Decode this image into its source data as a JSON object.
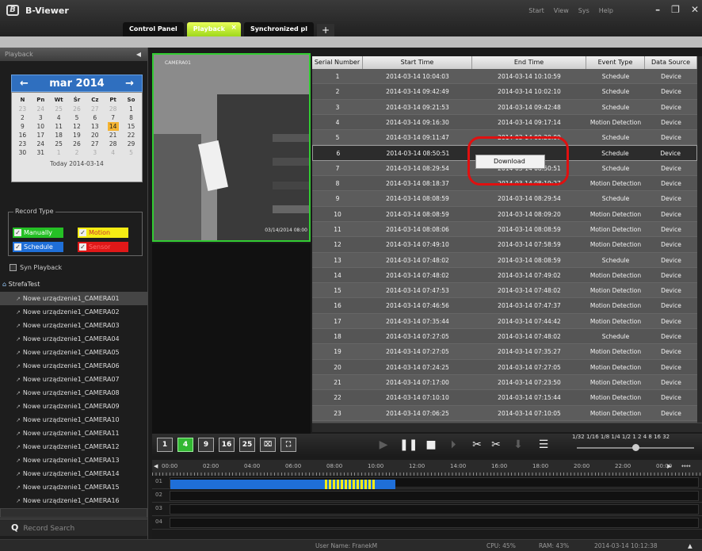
{
  "app": {
    "title": "B-Viewer",
    "logo_letter": "B"
  },
  "top_menu": [
    "Start",
    "View",
    "Sys",
    "Help"
  ],
  "tabs": [
    {
      "label": "Control Panel",
      "active": false
    },
    {
      "label": "Playback",
      "active": true,
      "close": "×"
    },
    {
      "label": "Synchronized pl",
      "active": false
    }
  ],
  "tab_add": "+",
  "left_panel": {
    "title": "Playback",
    "calendar": {
      "month": "mar",
      "year": "2014",
      "dow": [
        "N",
        "Pn",
        "Wt",
        "Śr",
        "Cz",
        "Pt",
        "So"
      ],
      "weeks": [
        [
          "23",
          "24",
          "25",
          "26",
          "27",
          "28",
          "1"
        ],
        [
          "2",
          "3",
          "4",
          "5",
          "6",
          "7",
          "8"
        ],
        [
          "9",
          "10",
          "11",
          "12",
          "13",
          "14",
          "15"
        ],
        [
          "16",
          "17",
          "18",
          "19",
          "20",
          "21",
          "22"
        ],
        [
          "23",
          "24",
          "25",
          "26",
          "27",
          "28",
          "29"
        ],
        [
          "30",
          "31",
          "1",
          "2",
          "3",
          "4",
          "5"
        ]
      ],
      "selected_day": "14",
      "today": "Today 2014-03-14"
    },
    "record_type": {
      "legend": "Record Type",
      "manually": "Manually",
      "motion": "Motion",
      "schedule": "Schedule",
      "sensor": "Sensor"
    },
    "syn_playback": "Syn Playback",
    "tree_root": "StrefaTest",
    "cameras": [
      "Nowe urządzenie1_CAMERA01",
      "Nowe urządzenie1_CAMERA02",
      "Nowe urządzenie1_CAMERA03",
      "Nowe urządzenie1_CAMERA04",
      "Nowe urządzenie1_CAMERA05",
      "Nowe urządzenie1_CAMERA06",
      "Nowe urządzenie1_CAMERA07",
      "Nowe urządzenie1_CAMERA08",
      "Nowe urządzenie1_CAMERA09",
      "Nowe urządzenie1_CAMERA10",
      "Nowe urządzenie1_CAMERA11",
      "Nowe urządzenie1_CAMERA12",
      "Nowe urządzenie1_CAMERA13",
      "Nowe urządzenie1_CAMERA14",
      "Nowe urządzenie1_CAMERA15",
      "Nowe urządzenie1_CAMERA16"
    ],
    "selected_camera": 0,
    "search_label": "Record Search"
  },
  "video": {
    "camera_label": "CAMERA01",
    "timestamp": "03/14/2014 08:00"
  },
  "table": {
    "headers": [
      "Serial Number",
      "Start Time",
      "End Time",
      "Event Type",
      "Data Source"
    ],
    "selected_row": 5,
    "rows": [
      [
        "1",
        "2014-03-14 10:04:03",
        "2014-03-14 10:10:59",
        "Schedule",
        "Device"
      ],
      [
        "2",
        "2014-03-14 09:42:49",
        "2014-03-14 10:02:10",
        "Schedule",
        "Device"
      ],
      [
        "3",
        "2014-03-14 09:21:53",
        "2014-03-14 09:42:48",
        "Schedule",
        "Device"
      ],
      [
        "4",
        "2014-03-14 09:16:30",
        "2014-03-14 09:17:14",
        "Motion Detection",
        "Device"
      ],
      [
        "5",
        "2014-03-14 09:11:47",
        "2014-03-14 09:20:00",
        "Schedule",
        "Device"
      ],
      [
        "6",
        "2014-03-14 08:50:51",
        "",
        "Schedule",
        "Device"
      ],
      [
        "7",
        "2014-03-14 08:29:54",
        "2014-03-14 08:50:51",
        "Schedule",
        "Device"
      ],
      [
        "8",
        "2014-03-14 08:18:37",
        "2014-03-14 08:19:27",
        "Motion Detection",
        "Device"
      ],
      [
        "9",
        "2014-03-14 08:08:59",
        "2014-03-14 08:29:54",
        "Schedule",
        "Device"
      ],
      [
        "10",
        "2014-03-14 08:08:59",
        "2014-03-14 08:09:20",
        "Motion Detection",
        "Device"
      ],
      [
        "11",
        "2014-03-14 08:08:06",
        "2014-03-14 08:08:59",
        "Motion Detection",
        "Device"
      ],
      [
        "12",
        "2014-03-14 07:49:10",
        "2014-03-14 07:58:59",
        "Motion Detection",
        "Device"
      ],
      [
        "13",
        "2014-03-14 07:48:02",
        "2014-03-14 08:08:59",
        "Schedule",
        "Device"
      ],
      [
        "14",
        "2014-03-14 07:48:02",
        "2014-03-14 07:49:02",
        "Motion Detection",
        "Device"
      ],
      [
        "15",
        "2014-03-14 07:47:53",
        "2014-03-14 07:48:02",
        "Motion Detection",
        "Device"
      ],
      [
        "16",
        "2014-03-14 07:46:56",
        "2014-03-14 07:47:37",
        "Motion Detection",
        "Device"
      ],
      [
        "17",
        "2014-03-14 07:35:44",
        "2014-03-14 07:44:42",
        "Motion Detection",
        "Device"
      ],
      [
        "18",
        "2014-03-14 07:27:05",
        "2014-03-14 07:48:02",
        "Schedule",
        "Device"
      ],
      [
        "19",
        "2014-03-14 07:27:05",
        "2014-03-14 07:35:27",
        "Motion Detection",
        "Device"
      ],
      [
        "20",
        "2014-03-14 07:24:25",
        "2014-03-14 07:27:05",
        "Motion Detection",
        "Device"
      ],
      [
        "21",
        "2014-03-14 07:17:00",
        "2014-03-14 07:23:50",
        "Motion Detection",
        "Device"
      ],
      [
        "22",
        "2014-03-14 07:10:10",
        "2014-03-14 07:15:44",
        "Motion Detection",
        "Device"
      ],
      [
        "23",
        "2014-03-14 07:06:25",
        "2014-03-14 07:10:05",
        "Motion Detection",
        "Device"
      ]
    ]
  },
  "context_menu": {
    "item": "Download"
  },
  "toolbar": {
    "splits": [
      "1",
      "4",
      "9",
      "16",
      "25"
    ],
    "active_split": "4",
    "speed_labels": "1/32 1/16 1/8 1/4 1/2  1    2    4    8   16  32"
  },
  "timeline": {
    "hours": [
      "00:00",
      "02:00",
      "04:00",
      "06:00",
      "08:00",
      "10:00",
      "12:00",
      "14:00",
      "16:00",
      "18:00",
      "20:00",
      "22:00",
      "00:00"
    ],
    "rows": [
      "01",
      "02",
      "03",
      "04"
    ],
    "colors": {
      "schedule": "#1f6fd8",
      "motion": "#f5ec14"
    }
  },
  "status": {
    "user": "User Name: FranekM",
    "cpu": "CPU: 45%",
    "ram": "RAM: 43%",
    "datetime": "2014-03-14 10:12:38"
  }
}
